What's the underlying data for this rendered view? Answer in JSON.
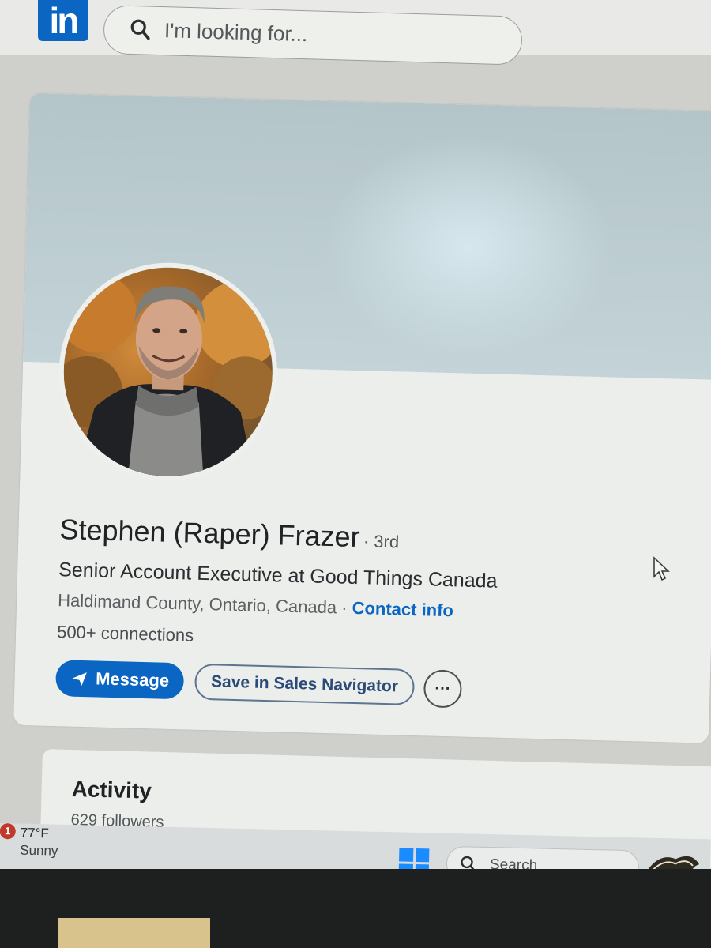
{
  "brand": {
    "logo_text": "in",
    "color": "#0a66c2"
  },
  "search": {
    "placeholder": "I'm looking for..."
  },
  "profile": {
    "name": "Stephen (Raper) Frazer",
    "degree": "· 3rd",
    "headline": "Senior Account Executive at Good Things Canada",
    "location": "Haldimand County, Ontario, Canada",
    "location_separator": " · ",
    "contact_info_label": "Contact info",
    "connections": "500+ connections",
    "actions": {
      "message_label": "Message",
      "save_label": "Save in Sales Navigator",
      "more_label": "···"
    }
  },
  "activity": {
    "title": "Activity",
    "followers": "629 followers"
  },
  "taskbar": {
    "weather_badge": "1",
    "weather_temp": "77°F",
    "weather_condition": "Sunny",
    "search_label": "Search"
  },
  "icons": {
    "search": "search-icon",
    "send": "send-icon",
    "start": "windows-start-icon",
    "cursor": "mouse-cursor-icon"
  }
}
